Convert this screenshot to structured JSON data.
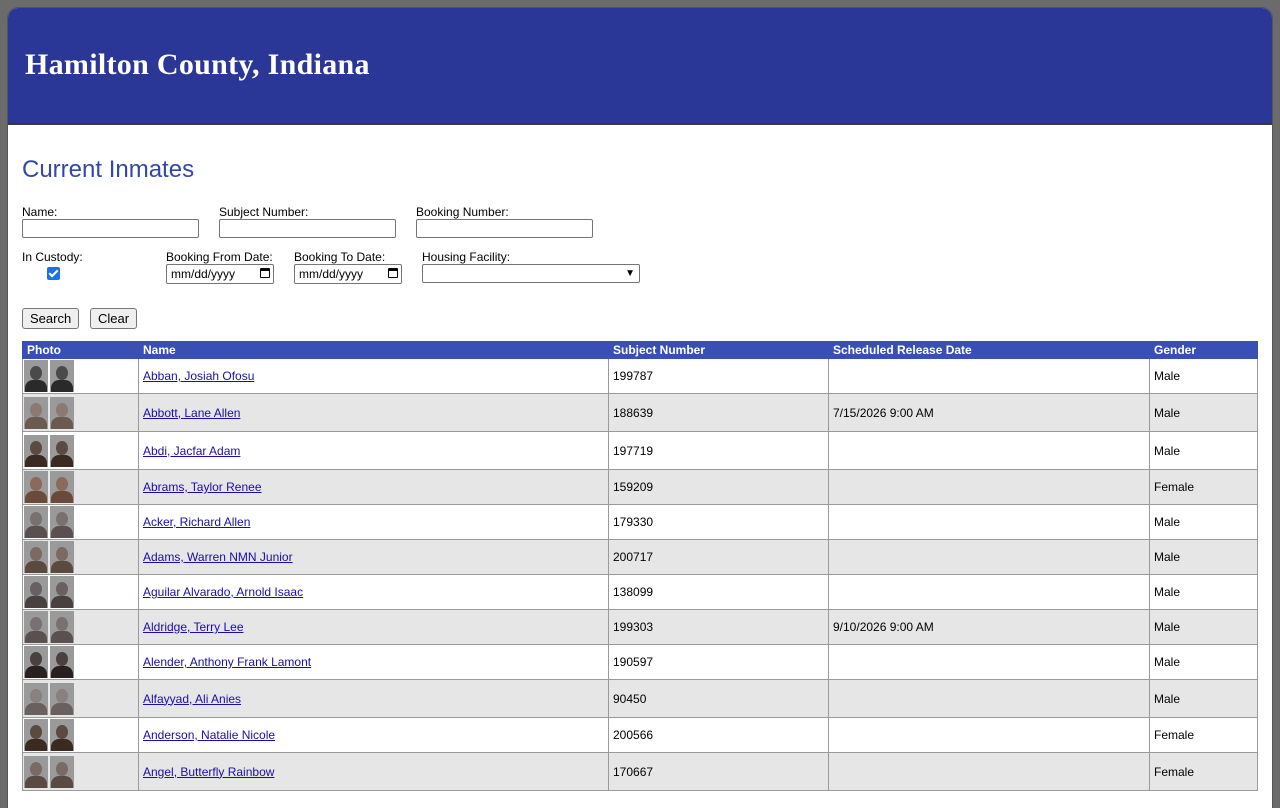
{
  "header": {
    "title": "Hamilton County, Indiana"
  },
  "page_title": "Current Inmates",
  "form": {
    "name_label": "Name:",
    "subject_label": "Subject Number:",
    "booking_label": "Booking Number:",
    "custody_label": "In Custody:",
    "from_label": "Booking From Date:",
    "to_label": "Booking To Date:",
    "housing_label": "Housing Facility:",
    "from_placeholder": "mm/dd/yyyy",
    "to_placeholder": "mm/dd/yyyy",
    "in_custody_checked": true,
    "search_label": "Search",
    "clear_label": "Clear"
  },
  "table": {
    "headers": [
      "Photo",
      "Name",
      "Subject Number",
      "Scheduled Release Date",
      "Gender"
    ],
    "rows": [
      {
        "name": "Abban, Josiah Ofosu",
        "subject": "199787",
        "release": "",
        "gender": "Male"
      },
      {
        "name": "Abbott, Lane Allen",
        "subject": "188639",
        "release": "7/15/2026 9:00 AM",
        "gender": "Male"
      },
      {
        "name": "Abdi, Jacfar Adam",
        "subject": "197719",
        "release": "",
        "gender": "Male"
      },
      {
        "name": "Abrams, Taylor Renee",
        "subject": "159209",
        "release": "",
        "gender": "Female"
      },
      {
        "name": "Acker, Richard Allen",
        "subject": "179330",
        "release": "",
        "gender": "Male"
      },
      {
        "name": "Adams, Warren NMN Junior",
        "subject": "200717",
        "release": "",
        "gender": "Male"
      },
      {
        "name": "Aguilar Alvarado, Arnold Isaac",
        "subject": "138099",
        "release": "",
        "gender": "Male"
      },
      {
        "name": "Aldridge, Terry Lee",
        "subject": "199303",
        "release": "9/10/2026 9:00 AM",
        "gender": "Male"
      },
      {
        "name": "Alender, Anthony Frank Lamont",
        "subject": "190597",
        "release": "",
        "gender": "Male"
      },
      {
        "name": "Alfayyad, Ali Anies",
        "subject": "90450",
        "release": "",
        "gender": "Male"
      },
      {
        "name": "Anderson, Natalie Nicole",
        "subject": "200566",
        "release": "",
        "gender": "Female"
      },
      {
        "name": "Angel, Butterfly Rainbow",
        "subject": "170667",
        "release": "",
        "gender": "Female"
      }
    ]
  }
}
